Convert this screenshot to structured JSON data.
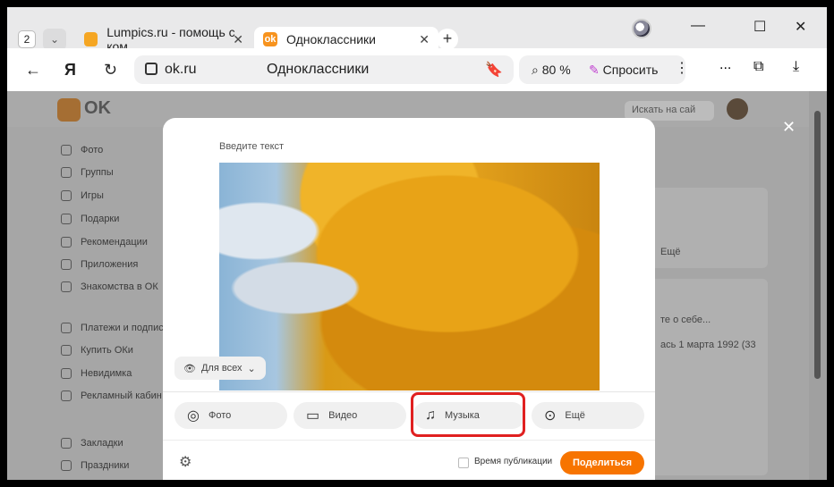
{
  "browser": {
    "tab_count": "2",
    "tabs": [
      {
        "label": "Lumpics.ru - помощь с ком"
      },
      {
        "label": "Одноклассники"
      }
    ],
    "url": "ok.ru",
    "page_title": "Одноклассники",
    "zoom": "80 %",
    "ask_label": "Спросить",
    "more_label": "..."
  },
  "ok": {
    "logo_text": "OK",
    "search_placeholder": "Искать на сай",
    "sidebar": [
      {
        "label": "Фото"
      },
      {
        "label": "Группы"
      },
      {
        "label": "Игры"
      },
      {
        "label": "Подарки"
      },
      {
        "label": "Рекомендации"
      },
      {
        "label": "Приложения"
      },
      {
        "label": "Знакомства в ОК"
      },
      {
        "label": "Платежи и подпис"
      },
      {
        "label": "Купить ОКи"
      },
      {
        "label": "Невидимка"
      },
      {
        "label": "Рекламный кабин"
      },
      {
        "label": "Закладки"
      },
      {
        "label": "Праздники"
      }
    ],
    "right": {
      "more": "Ещё",
      "about_placeholder": "те о себе...",
      "birth": "ась 1 марта 1992 (33"
    }
  },
  "composer": {
    "placeholder": "Введите текст",
    "audience": "Для всех",
    "actions": [
      {
        "label": "Фото"
      },
      {
        "label": "Видео"
      },
      {
        "label": "Музыка"
      },
      {
        "label": "Ещё"
      }
    ],
    "schedule_label": "Время публикации",
    "share_label": "Поделиться"
  }
}
